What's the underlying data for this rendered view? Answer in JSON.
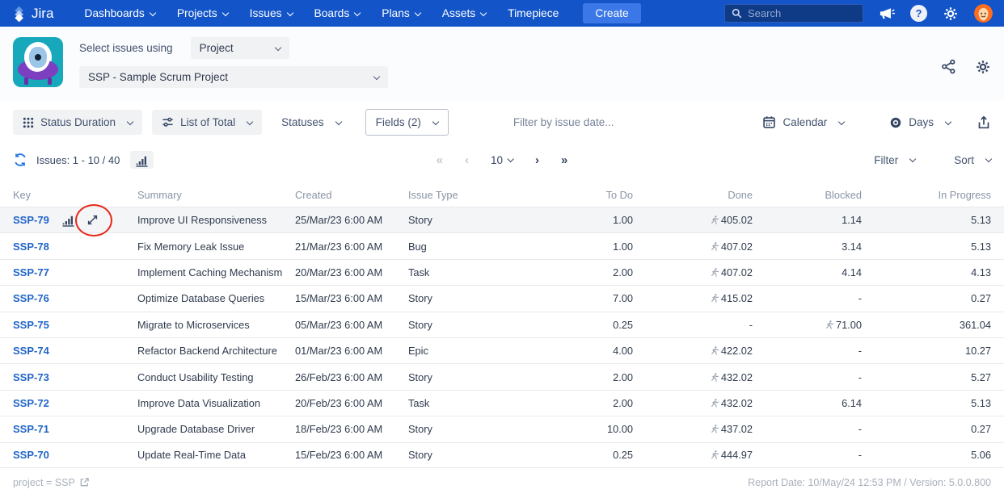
{
  "nav": {
    "brand": "Jira",
    "items": [
      "Dashboards",
      "Projects",
      "Issues",
      "Boards",
      "Plans",
      "Assets",
      "Timepiece"
    ],
    "create_label": "Create",
    "search_placeholder": "Search",
    "icons": [
      "megaphone-icon",
      "help-icon",
      "gear-icon",
      "avatar"
    ]
  },
  "header": {
    "select_issues_label": "Select issues using",
    "mode_value": "Project",
    "project_value": "SSP - Sample Scrum Project",
    "icons": [
      "share-icon",
      "settings-gear-icon"
    ]
  },
  "toolbar": {
    "status_duration": "Status Duration",
    "list_of_total": "List of Total",
    "statuses": "Statuses",
    "fields": "Fields (2)",
    "date_filter_placeholder": "Filter by issue date...",
    "calendar": "Calendar",
    "days": "Days",
    "icons": [
      "grid-icon",
      "sliders-icon",
      "calendar-icon",
      "target-eye-icon",
      "export-icon"
    ]
  },
  "issues_bar": {
    "count_label": "Issues: 1 - 10 / 40",
    "pager": {
      "first": "«",
      "prev": "‹",
      "page_size": "10",
      "next": "›",
      "last": "»"
    },
    "filter": "Filter",
    "sort": "Sort",
    "icons": [
      "refresh-icon",
      "bar-chart-icon"
    ]
  },
  "table": {
    "columns": [
      "Key",
      "Summary",
      "Created",
      "Issue Type",
      "To Do",
      "Done",
      "Blocked",
      "In Progress"
    ],
    "rows": [
      {
        "key": "SSP-79",
        "summary": "Improve UI Responsiveness",
        "created": "25/Mar/23 6:00 AM",
        "issue_type": "Story",
        "to_do": "1.00",
        "done": "405.02",
        "done_runner": true,
        "blocked": "1.14",
        "blocked_runner": false,
        "in_progress": "5.13",
        "highlighted": true,
        "icons": true,
        "annotated": true
      },
      {
        "key": "SSP-78",
        "summary": "Fix Memory Leak Issue",
        "created": "21/Mar/23 6:00 AM",
        "issue_type": "Bug",
        "to_do": "1.00",
        "done": "407.02",
        "done_runner": true,
        "blocked": "3.14",
        "blocked_runner": false,
        "in_progress": "5.13"
      },
      {
        "key": "SSP-77",
        "summary": "Implement Caching Mechanism",
        "created": "20/Mar/23 6:00 AM",
        "issue_type": "Task",
        "to_do": "2.00",
        "done": "407.02",
        "done_runner": true,
        "blocked": "4.14",
        "blocked_runner": false,
        "in_progress": "4.13"
      },
      {
        "key": "SSP-76",
        "summary": "Optimize Database Queries",
        "created": "15/Mar/23 6:00 AM",
        "issue_type": "Story",
        "to_do": "7.00",
        "done": "415.02",
        "done_runner": true,
        "blocked": "-",
        "blocked_runner": false,
        "in_progress": "0.27"
      },
      {
        "key": "SSP-75",
        "summary": "Migrate to Microservices",
        "created": "05/Mar/23 6:00 AM",
        "issue_type": "Story",
        "to_do": "0.25",
        "done": "-",
        "done_runner": false,
        "blocked": "71.00",
        "blocked_runner": true,
        "in_progress": "361.04"
      },
      {
        "key": "SSP-74",
        "summary": "Refactor Backend Architecture",
        "created": "01/Mar/23 6:00 AM",
        "issue_type": "Epic",
        "to_do": "4.00",
        "done": "422.02",
        "done_runner": true,
        "blocked": "-",
        "blocked_runner": false,
        "in_progress": "10.27"
      },
      {
        "key": "SSP-73",
        "summary": "Conduct Usability Testing",
        "created": "26/Feb/23 6:00 AM",
        "issue_type": "Story",
        "to_do": "2.00",
        "done": "432.02",
        "done_runner": true,
        "blocked": "-",
        "blocked_runner": false,
        "in_progress": "5.27"
      },
      {
        "key": "SSP-72",
        "summary": "Improve Data Visualization",
        "created": "20/Feb/23 6:00 AM",
        "issue_type": "Task",
        "to_do": "2.00",
        "done": "432.02",
        "done_runner": true,
        "blocked": "6.14",
        "blocked_runner": false,
        "in_progress": "5.13"
      },
      {
        "key": "SSP-71",
        "summary": "Upgrade Database Driver",
        "created": "18/Feb/23 6:00 AM",
        "issue_type": "Story",
        "to_do": "10.00",
        "done": "437.02",
        "done_runner": true,
        "blocked": "-",
        "blocked_runner": false,
        "in_progress": "0.27"
      },
      {
        "key": "SSP-70",
        "summary": "Update Real-Time Data",
        "created": "15/Feb/23 6:00 AM",
        "issue_type": "Story",
        "to_do": "0.25",
        "done": "444.97",
        "done_runner": true,
        "blocked": "-",
        "blocked_runner": false,
        "in_progress": "5.06"
      }
    ]
  },
  "footer": {
    "left": "project = SSP",
    "right": "Report Date: 10/May/24 12:53 PM / Version: 5.0.0.800"
  },
  "colors": {
    "nav_bg": "#1355c8",
    "create_bg": "#3b77e6",
    "link_blue": "#2065c8",
    "navy": "#344563",
    "annotation_red": "#e8291c",
    "app_icon_teal": "#17a8bc",
    "app_icon_purple": "#7b3fbf",
    "avatar_orange": "#ff6d1f",
    "refresh_blue": "#2477e5",
    "row_highlight": "#f4f5f7"
  }
}
